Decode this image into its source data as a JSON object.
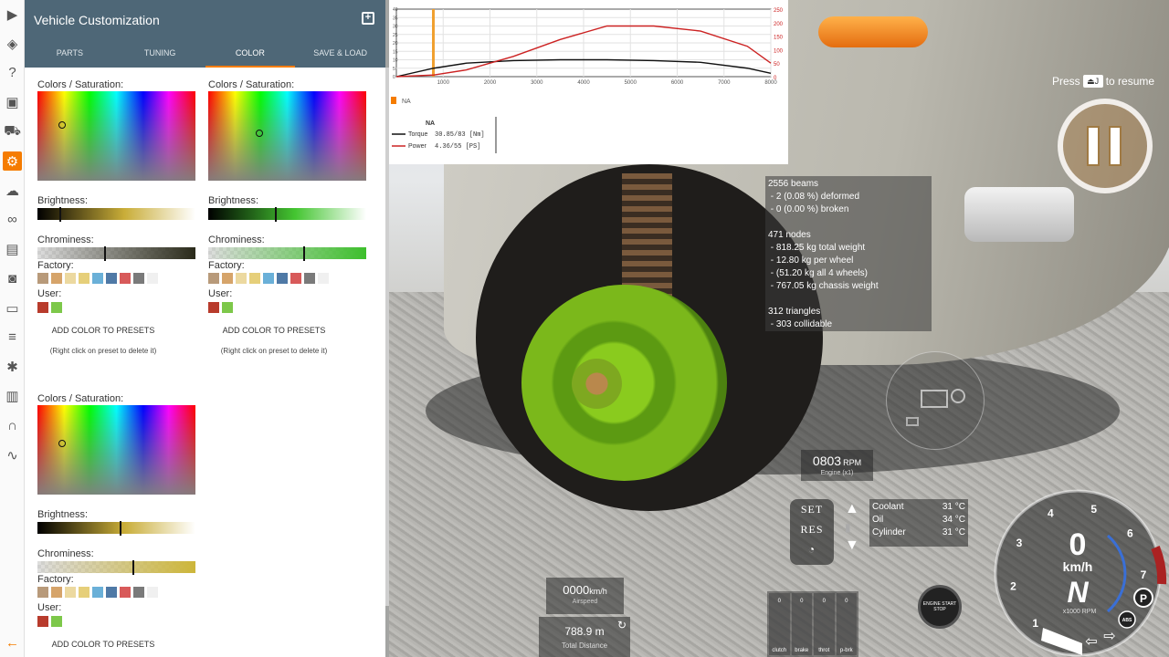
{
  "sidebar": {
    "icons": [
      "play-icon",
      "layers-icon",
      "help-icon",
      "slideshow-icon",
      "car-icon",
      "settings-icon",
      "cloud-icon",
      "infinity-icon",
      "film-icon",
      "camera-icon",
      "browser-icon",
      "sliders-icon",
      "bug-icon",
      "bar-chart-icon",
      "headphones-icon",
      "route-icon"
    ],
    "back_icon": "arrow-left-icon"
  },
  "panel": {
    "title": "Vehicle Customization",
    "tabs": [
      "PARTS",
      "TUNING",
      "COLOR",
      "SAVE & LOAD"
    ],
    "active_tab": "COLOR",
    "blocks": [
      {
        "colors_label": "Colors / Saturation:",
        "brightness_label": "Brightness:",
        "chrominess_label": "Chrominess:",
        "factory_label": "Factory:",
        "user_label": "User:",
        "add_preset": "ADD COLOR TO PRESETS",
        "note": "(Right click on preset to delete it)",
        "brightness_color": "#c9ad38",
        "chrome_color": "#2a2a1a",
        "brightness_level": 0.14,
        "chrominess_level": 0.42
      },
      {
        "colors_label": "Colors / Saturation:",
        "brightness_label": "Brightness:",
        "chrominess_label": "Chrominess:",
        "factory_label": "Factory:",
        "user_label": "User:",
        "add_preset": "ADD COLOR TO PRESETS",
        "note": "(Right click on preset to delete it)",
        "brightness_color": "#44c531",
        "chrome_color": "#3dbf2c",
        "brightness_level": 0.42,
        "chrominess_level": 0.6
      },
      {
        "colors_label": "Colors / Saturation:",
        "brightness_label": "Brightness:",
        "chrominess_label": "Chrominess:",
        "factory_label": "Factory:",
        "user_label": "User:",
        "add_preset": "ADD COLOR TO PRESETS",
        "brightness_color": "#c9ad38",
        "chrome_color": "#cdb63a",
        "brightness_level": 0.52,
        "chrominess_level": 0.6
      }
    ],
    "factory_swatches": [
      "#b89a7a",
      "#d6a46a",
      "#ecd9a0",
      "#e6cf7a",
      "#6ab0d8",
      "#4f79a6",
      "#d85a5a",
      "#7a7a7a",
      "#f0f0f0"
    ],
    "user_swatches": [
      "#b83b2c",
      "#7dc84a"
    ]
  },
  "chart_data": {
    "type": "line",
    "x_ticks": [
      "1000",
      "2000",
      "3000",
      "4000",
      "5000",
      "6000",
      "7000",
      "8000"
    ],
    "y_left_ticks": [
      "40",
      "35",
      "30",
      "25",
      "20",
      "15",
      "10",
      "5",
      "0"
    ],
    "y_right_ticks": [
      "250",
      "200",
      "150",
      "100",
      "50",
      "0"
    ],
    "xlim": [
      0,
      8000
    ],
    "ylim_left": [
      0,
      40
    ],
    "ylim_right": [
      0,
      250
    ],
    "legend_toggle_label": "NA",
    "legend_title": "NA",
    "series": [
      {
        "name": "Torque",
        "value": "30.85/83 [Nm]",
        "color": "#111111",
        "x": [
          0,
          800,
          1500,
          2500,
          3500,
          4500,
          5500,
          6500,
          7500,
          8000
        ],
        "y": [
          0,
          5,
          8,
          9.5,
          10,
          10,
          9.5,
          8.5,
          5,
          2
        ]
      },
      {
        "name": "Power",
        "value": "4.36/55 [PS]",
        "color": "#cc2222",
        "x": [
          0,
          800,
          1500,
          2500,
          3500,
          4500,
          5500,
          6500,
          7500,
          8000
        ],
        "y": [
          0,
          1,
          4,
          12,
          22,
          30,
          30,
          27,
          18,
          8
        ]
      }
    ],
    "marker_x": 800
  },
  "debug": {
    "beams": "2556 beams",
    "deformed": " - 2 (0.08 %) deformed",
    "broken": " - 0 (0.00 %) broken",
    "nodes": "471 nodes",
    "total_weight": " - 818.25 kg total weight",
    "per_wheel": " - 12.80 kg per wheel",
    "all_wheels": " - (51.20 kg all 4 wheels)",
    "chassis": " - 767.05 kg chassis weight",
    "triangles": "312 triangles",
    "collidable": " - 303 collidable"
  },
  "hud": {
    "pause_hint_prefix": "Press",
    "pause_hint_key": "⏏J",
    "pause_hint_suffix": "to resume",
    "rpm": "0803",
    "rpm_unit": "RPM",
    "rpm_sub": "Engine (x1)",
    "cruise": {
      "set": "SET",
      "res": "RES"
    },
    "temps": [
      {
        "label": "Coolant",
        "value": "31 °C"
      },
      {
        "label": "Oil",
        "value": "34 °C"
      },
      {
        "label": "Cylinder",
        "value": "31 °C"
      }
    ],
    "airspeed_value": "0000",
    "airspeed_unit": "km/h",
    "airspeed_label": "Airspeed",
    "distance_value": "788.9 m",
    "distance_label": "Total Distance",
    "pedals": [
      {
        "v": "0",
        "n": "clutch"
      },
      {
        "v": "0",
        "n": "brake"
      },
      {
        "v": "0",
        "n": "throt"
      },
      {
        "v": "0",
        "n": "p-brk"
      }
    ],
    "start_stop": "ENGINE START STOP",
    "gauge": {
      "ticks": [
        "1",
        "2",
        "3",
        "4",
        "5",
        "6",
        "7",
        "8"
      ],
      "speed": "0",
      "gear": "N",
      "unit": "km/h",
      "rpm_label": "x1000 RPM",
      "park": "P",
      "abs": "ABS"
    }
  }
}
